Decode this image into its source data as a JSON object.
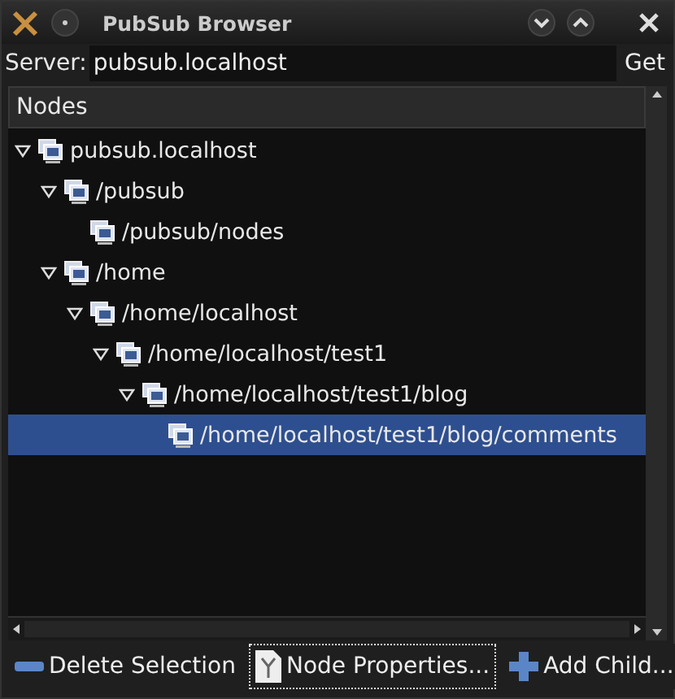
{
  "window": {
    "title": "PubSub Browser"
  },
  "server": {
    "label": "Server:",
    "value": "pubsub.localhost",
    "button": "Get"
  },
  "tree": {
    "header": "Nodes",
    "nodes": [
      {
        "label": "pubsub.localhost",
        "expanded": true,
        "selected": false,
        "children": [
          {
            "label": "/pubsub",
            "expanded": true,
            "selected": false,
            "children": [
              {
                "label": "/pubsub/nodes",
                "selected": false
              }
            ]
          },
          {
            "label": "/home",
            "expanded": true,
            "selected": false,
            "children": [
              {
                "label": "/home/localhost",
                "expanded": true,
                "selected": false,
                "children": [
                  {
                    "label": "/home/localhost/test1",
                    "expanded": true,
                    "selected": false,
                    "children": [
                      {
                        "label": "/home/localhost/test1/blog",
                        "expanded": true,
                        "selected": false,
                        "children": [
                          {
                            "label": "/home/localhost/test1/blog/comments",
                            "selected": true
                          }
                        ]
                      }
                    ]
                  }
                ]
              }
            ]
          }
        ]
      }
    ]
  },
  "buttons": [
    {
      "kind": "delete",
      "label": "Delete Selection",
      "focused": false
    },
    {
      "kind": "properties",
      "label": "Node Properties...",
      "focused": true
    },
    {
      "kind": "add",
      "label": "Add Child...",
      "focused": false
    }
  ]
}
